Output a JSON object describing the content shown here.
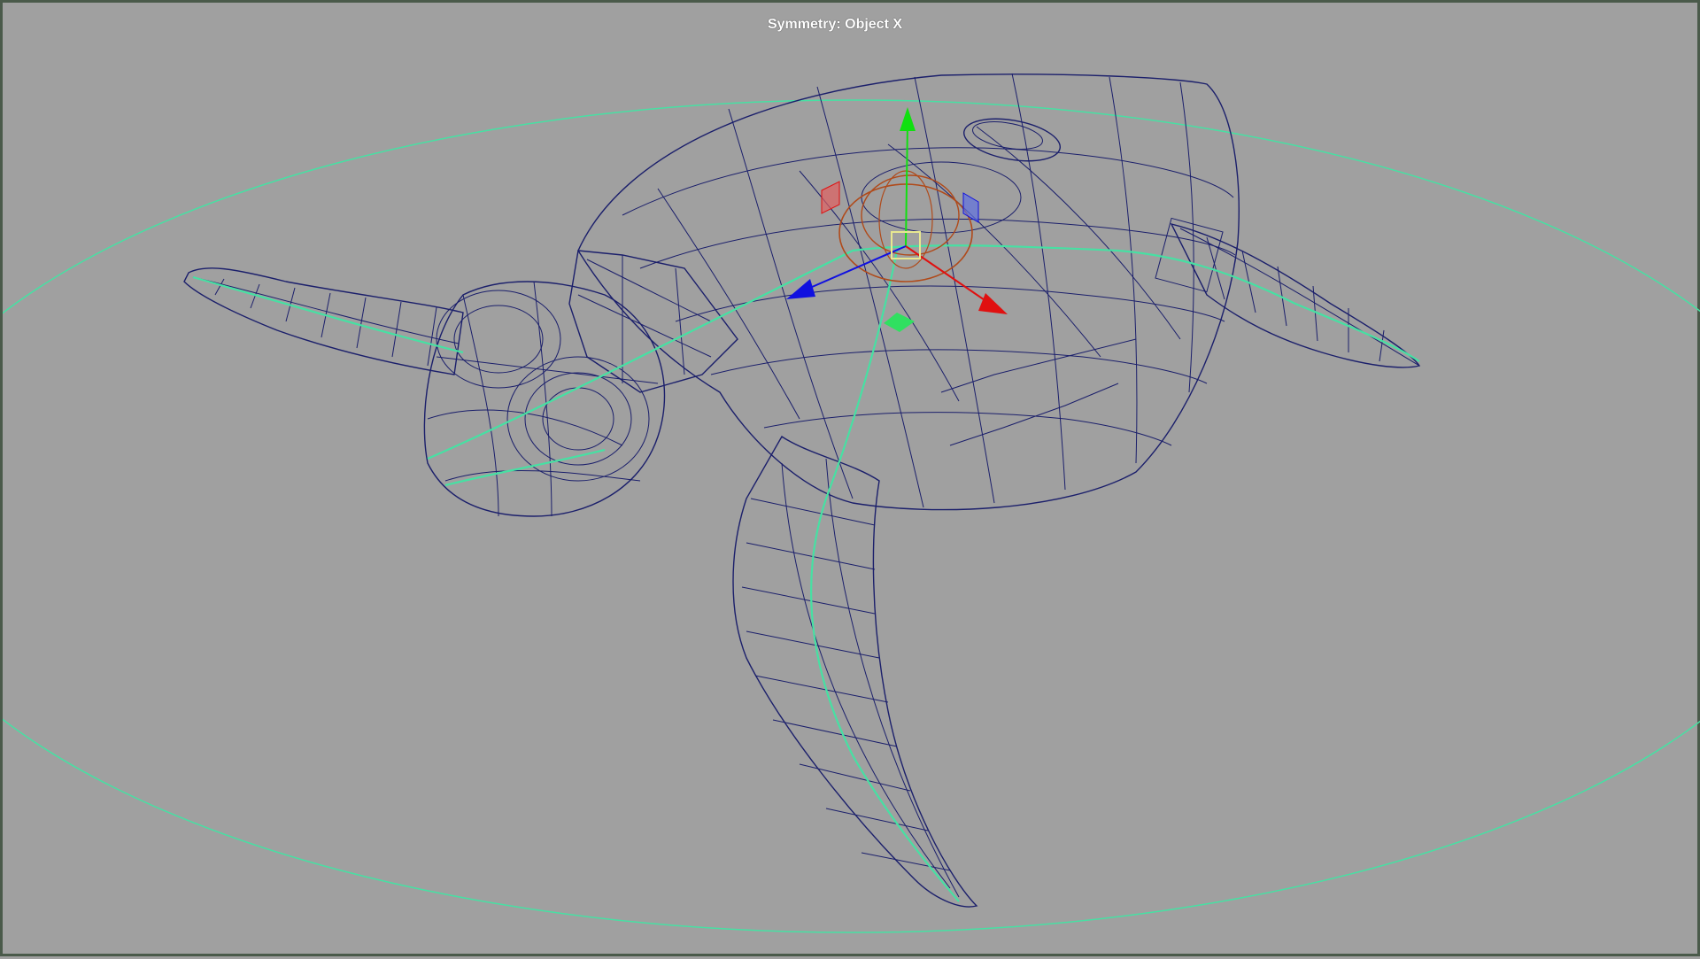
{
  "viewport": {
    "hud_text": "Symmetry: Object X"
  },
  "colors": {
    "background": "#a0a0a0",
    "wireframe": "#1b1f6b",
    "joint_curve": "#47e0a3",
    "axis_x": "#e01010",
    "axis_y": "#10e010",
    "axis_z": "#1010e0",
    "rotate_ring": "#b04a1a",
    "pivot_box": "#e8e890"
  },
  "icons": {
    "manipulator": "transform-manipulator-icon",
    "pivot": "pivot-handle-icon"
  }
}
